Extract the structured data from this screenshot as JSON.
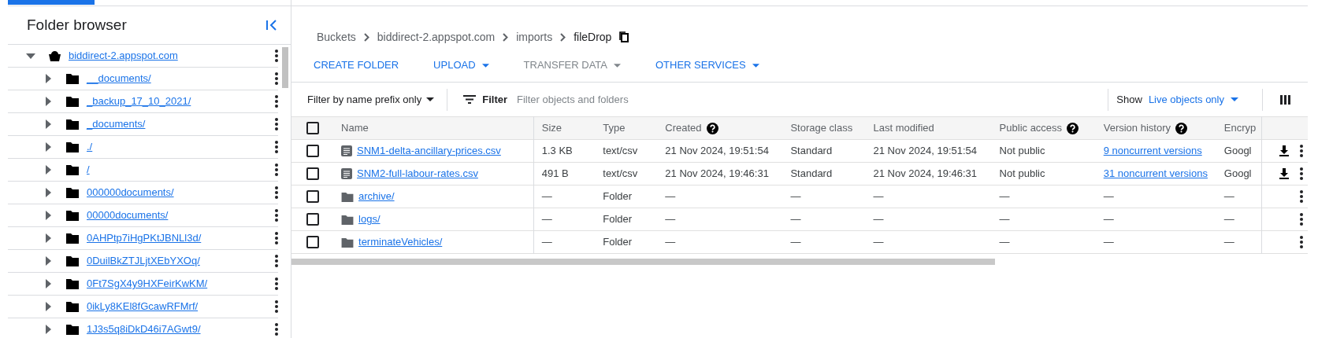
{
  "sidebar": {
    "title": "Folder browser",
    "tree": [
      {
        "label": "biddirect-2.appspot.com",
        "kind": "bucket",
        "expanded": true,
        "children": [
          {
            "label": "__documents/",
            "kind": "folder",
            "expanded": false
          },
          {
            "label": "_backup_17_10_2021/",
            "kind": "folder",
            "expanded": false
          },
          {
            "label": "_documents/",
            "kind": "folder",
            "expanded": false
          },
          {
            "label": "./",
            "kind": "folder",
            "expanded": false
          },
          {
            "label": "/",
            "kind": "folder",
            "expanded": false
          },
          {
            "label": "000000documents/",
            "kind": "folder",
            "expanded": false
          },
          {
            "label": "00000documents/",
            "kind": "folder",
            "expanded": false
          },
          {
            "label": "0AHPtp7iHgPKtJBNLl3d/",
            "kind": "folder",
            "expanded": false
          },
          {
            "label": "0DuilBkZTJLjtXEbYXOq/",
            "kind": "folder",
            "expanded": false
          },
          {
            "label": "0Ft7SgX4y9HXFeirKwKM/",
            "kind": "folder",
            "expanded": false
          },
          {
            "label": "0ikLy8KEl8fGcawRFMrf/",
            "kind": "folder",
            "expanded": false
          },
          {
            "label": "1J3s5q8iDkD46i7AGwt9/",
            "kind": "folder",
            "expanded": false
          }
        ]
      }
    ]
  },
  "breadcrumb": [
    {
      "label": "Buckets",
      "current": false
    },
    {
      "label": "biddirect-2.appspot.com",
      "current": false
    },
    {
      "label": "imports",
      "current": false
    },
    {
      "label": "fileDrop",
      "current": true
    }
  ],
  "actions": [
    {
      "label": "CREATE FOLDER",
      "dropdown": false,
      "disabled": false
    },
    {
      "label": "UPLOAD",
      "dropdown": true,
      "disabled": false
    },
    {
      "label": "TRANSFER DATA",
      "dropdown": true,
      "disabled": true
    },
    {
      "label": "OTHER SERVICES",
      "dropdown": true,
      "disabled": false
    }
  ],
  "filter_bar": {
    "mode": "Filter by name prefix only",
    "filter_label": "Filter",
    "placeholder": "Filter objects and folders",
    "show_label": "Show",
    "show_value": "Live objects only"
  },
  "table": {
    "select_all_checked": false,
    "columns": [
      {
        "label": "Name",
        "help": false
      },
      {
        "label": "Size",
        "help": false
      },
      {
        "label": "Type",
        "help": false
      },
      {
        "label": "Created",
        "help": true
      },
      {
        "label": "Storage class",
        "help": false
      },
      {
        "label": "Last modified",
        "help": false
      },
      {
        "label": "Public access",
        "help": true
      },
      {
        "label": "Version history",
        "help": true
      },
      {
        "label": "Encryp",
        "help": false
      }
    ],
    "rows": [
      {
        "kind": "file",
        "checked": false,
        "cells": [
          "SNM1-delta-ancillary-prices.csv",
          "1.3 KB",
          "text/csv",
          "21 Nov 2024, 19:51:54",
          "Standard",
          "21 Nov 2024, 19:51:54",
          "Not public",
          "9 noncurrent versions",
          "Googl"
        ]
      },
      {
        "kind": "file",
        "checked": false,
        "cells": [
          "SNM2-full-labour-rates.csv",
          "491 B",
          "text/csv",
          "21 Nov 2024, 19:46:31",
          "Standard",
          "21 Nov 2024, 19:46:31",
          "Not public",
          "31 noncurrent versions",
          "Googl"
        ]
      },
      {
        "kind": "folder",
        "checked": false,
        "cells": [
          "archive/",
          "—",
          "Folder",
          "—",
          "—",
          "—",
          "—",
          "—",
          "—"
        ]
      },
      {
        "kind": "folder",
        "checked": false,
        "cells": [
          "logs/",
          "—",
          "Folder",
          "—",
          "—",
          "—",
          "—",
          "—",
          "—"
        ]
      },
      {
        "kind": "folder",
        "checked": false,
        "cells": [
          "terminateVehicles/",
          "—",
          "Folder",
          "—",
          "—",
          "—",
          "—",
          "—",
          "—"
        ]
      }
    ]
  }
}
